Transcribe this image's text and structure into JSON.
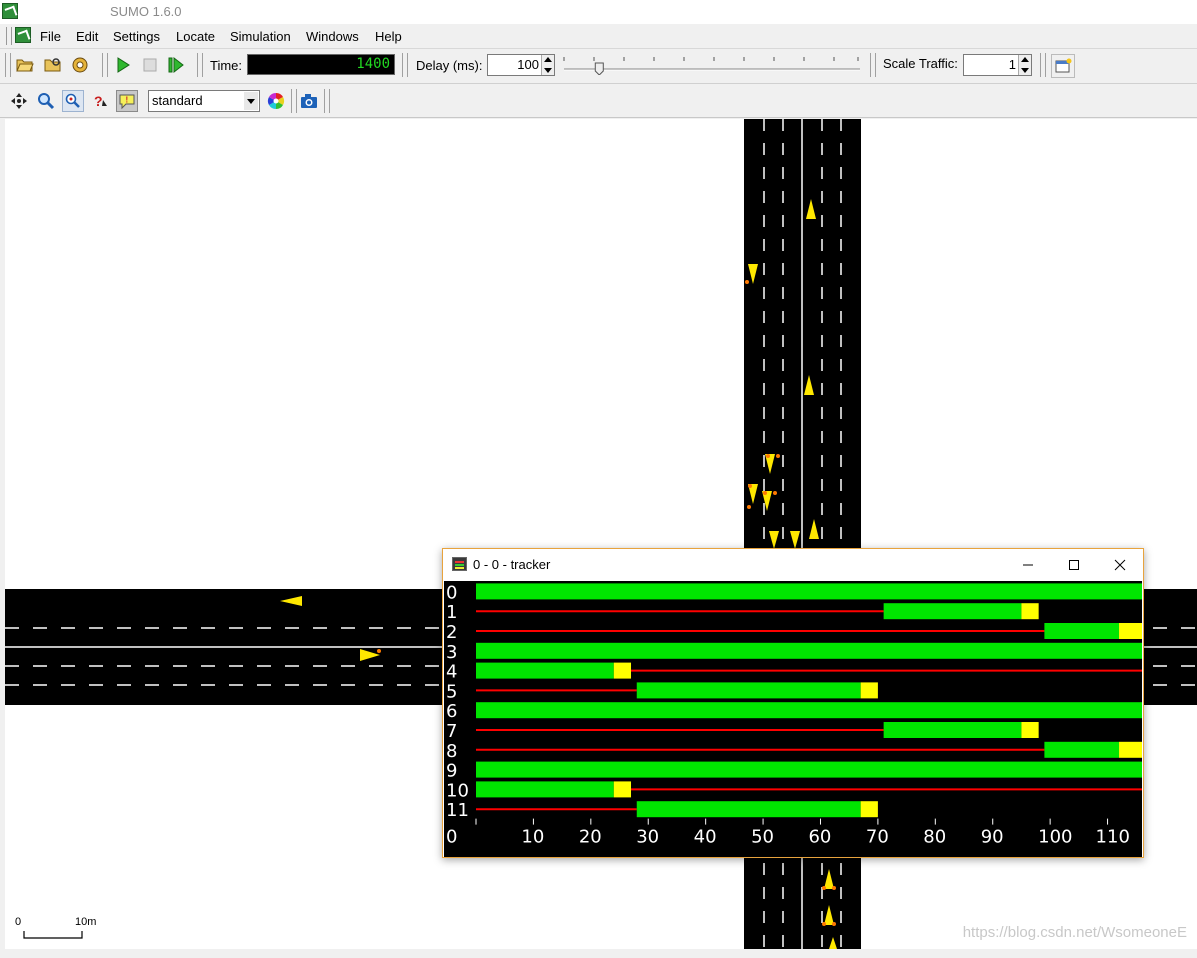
{
  "window": {
    "title": "SUMO 1.6.0"
  },
  "menu": [
    "File",
    "Edit",
    "Settings",
    "Locate",
    "Simulation",
    "Windows",
    "Help"
  ],
  "toolbar": {
    "time_label": "Time:",
    "time_value": "1400",
    "delay_label": "Delay (ms):",
    "delay_value": "100",
    "delay_slider_fraction": 0.12,
    "scale_label": "Scale Traffic:",
    "scale_value": "1"
  },
  "view": {
    "scheme": "standard"
  },
  "icons": {
    "open": "open-folder-icon",
    "reload": "reload-icon",
    "open-sim": "open-simulation-icon",
    "run": "run-icon",
    "stop": "stop-icon",
    "step": "step-icon",
    "recenter": "recenter-icon",
    "locate": "magnifier-icon",
    "locate-object": "locate-object-icon",
    "query": "query-icon",
    "tooltip": "tooltip-icon",
    "color": "color-wheel-icon",
    "screenshot": "camera-icon",
    "new-view": "new-view-icon"
  },
  "scale_bar": {
    "start": "0",
    "end": "10m"
  },
  "tracker": {
    "title": "0 - 0 - tracker",
    "rows": [
      "0",
      "1",
      "2",
      "3",
      "4",
      "5",
      "6",
      "7",
      "8",
      "9",
      "10",
      "11"
    ],
    "x_ticks": [
      "0",
      "10",
      "20",
      "30",
      "40",
      "50",
      "60",
      "70",
      "80",
      "90",
      "100",
      "110"
    ],
    "x_max": 116,
    "colors": {
      "green": "#00e600",
      "yellow": "#ffff00",
      "red": "#ff0000"
    },
    "signals": [
      [
        [
          "g",
          0,
          116
        ]
      ],
      [
        [
          "r",
          0,
          71
        ],
        [
          "g",
          71,
          95
        ],
        [
          "y",
          95,
          98
        ]
      ],
      [
        [
          "r",
          0,
          99
        ],
        [
          "g",
          99,
          112
        ],
        [
          "y",
          112,
          116
        ]
      ],
      [
        [
          "g",
          0,
          116
        ]
      ],
      [
        [
          "g",
          0,
          24
        ],
        [
          "y",
          24,
          27
        ],
        [
          "r",
          27,
          116
        ]
      ],
      [
        [
          "r",
          0,
          28
        ],
        [
          "g",
          28,
          67
        ],
        [
          "y",
          67,
          70
        ]
      ],
      [
        [
          "g",
          0,
          116
        ]
      ],
      [
        [
          "r",
          0,
          71
        ],
        [
          "g",
          71,
          95
        ],
        [
          "y",
          95,
          98
        ]
      ],
      [
        [
          "r",
          0,
          99
        ],
        [
          "g",
          99,
          112
        ],
        [
          "y",
          112,
          116
        ]
      ],
      [
        [
          "g",
          0,
          116
        ]
      ],
      [
        [
          "g",
          0,
          24
        ],
        [
          "y",
          24,
          27
        ],
        [
          "r",
          27,
          116
        ]
      ],
      [
        [
          "r",
          0,
          28
        ],
        [
          "g",
          28,
          67
        ],
        [
          "y",
          67,
          70
        ]
      ]
    ]
  },
  "watermark": "https://blog.csdn.net/WsomeoneE"
}
